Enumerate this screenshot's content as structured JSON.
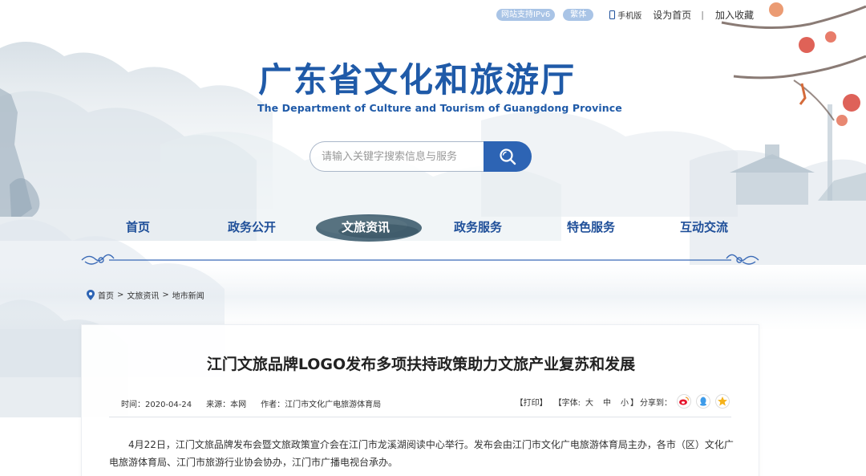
{
  "topbar": {
    "ipv6": "网站支持IPv6",
    "traditional": "繁体",
    "mobile": "手机版",
    "set_home": "设为首页",
    "separator": "|",
    "bookmark": "加入收藏"
  },
  "header": {
    "title": "广东省文化和旅游厅",
    "subtitle": "The Department of Culture and Tourism of Guangdong Province"
  },
  "search": {
    "placeholder": "请输入关键字搜索信息与服务",
    "icon": "search-icon"
  },
  "nav": {
    "items": [
      {
        "label": "首页"
      },
      {
        "label": "政务公开"
      },
      {
        "label": "文旅资讯",
        "active": true
      },
      {
        "label": "政务服务"
      },
      {
        "label": "特色服务"
      },
      {
        "label": "互动交流"
      }
    ]
  },
  "breadcrumb": {
    "icon": "location-pin-icon",
    "items": [
      "首页",
      "文旅资讯",
      "地市新闻"
    ],
    "separator": ">"
  },
  "article": {
    "title": "江门文旅品牌LOGO发布多项扶持政策助力文旅产业复苏和发展",
    "meta": {
      "time": "时间：2020-04-24",
      "source": "来源：本网",
      "author": "作者：江门市文化广电旅游体育局"
    },
    "tools": {
      "print": "【打印】",
      "font_label": "【字体:",
      "font_large": "大",
      "font_medium": "中",
      "font_small": "小",
      "font_close": "】",
      "share_label": "分享到："
    },
    "body": "4月22日，江门文旅品牌发布会暨文旅政策宣介会在江门市龙溪湖阅读中心举行。发布会由江门市文化广电旅游体育局主办，各市（区）文化广电旅游体育局、江门市旅游行业协会协办，江门市广播电视台承办。"
  },
  "colors": {
    "brand_blue": "#1f5aa8",
    "nav_blue": "#1f4f99",
    "search_button": "#2d64b4",
    "pill": "#a9c4e6"
  }
}
